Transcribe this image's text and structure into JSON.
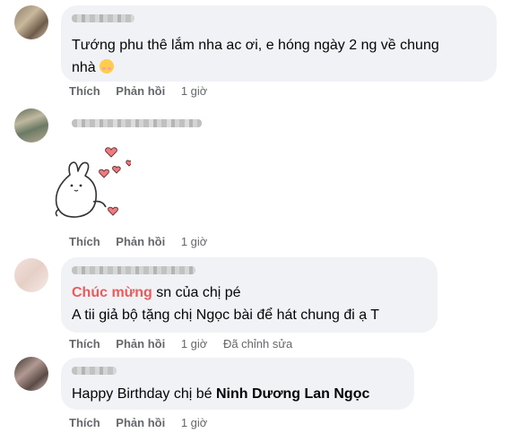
{
  "comments": [
    {
      "text_line1": "Tướng phu thê lắm nha ac ơi, e hóng ngày 2 ng về chung",
      "text_line2": "nhà",
      "emoji": "smiling-face-icon",
      "actions": {
        "like": "Thích",
        "reply": "Phản hồi",
        "time": "1 giờ"
      }
    },
    {
      "sticker": "bunny-hearts-sticker",
      "actions": {
        "like": "Thích",
        "reply": "Phản hồi",
        "time": "1 giờ"
      }
    },
    {
      "text_red": "Chúc mừng",
      "text_rest": " sn của chị pé",
      "text_line2": "A tii giả bộ tặng chị Ngọc bài để hát chung đi ạ T",
      "actions": {
        "like": "Thích",
        "reply": "Phản hồi",
        "time": "1 giờ",
        "edited": "Đã chỉnh sửa"
      }
    },
    {
      "text_plain": "Happy Birthday chị bé ",
      "text_bold": "Ninh Dương Lan Ngọc",
      "actions": {
        "like": "Thích",
        "reply": "Phản hồi",
        "time": "1 giờ"
      }
    }
  ],
  "colors": {
    "bubble": "#f0f2f5",
    "meta_text": "#65676b",
    "highlight_text": "#e95c5c"
  }
}
